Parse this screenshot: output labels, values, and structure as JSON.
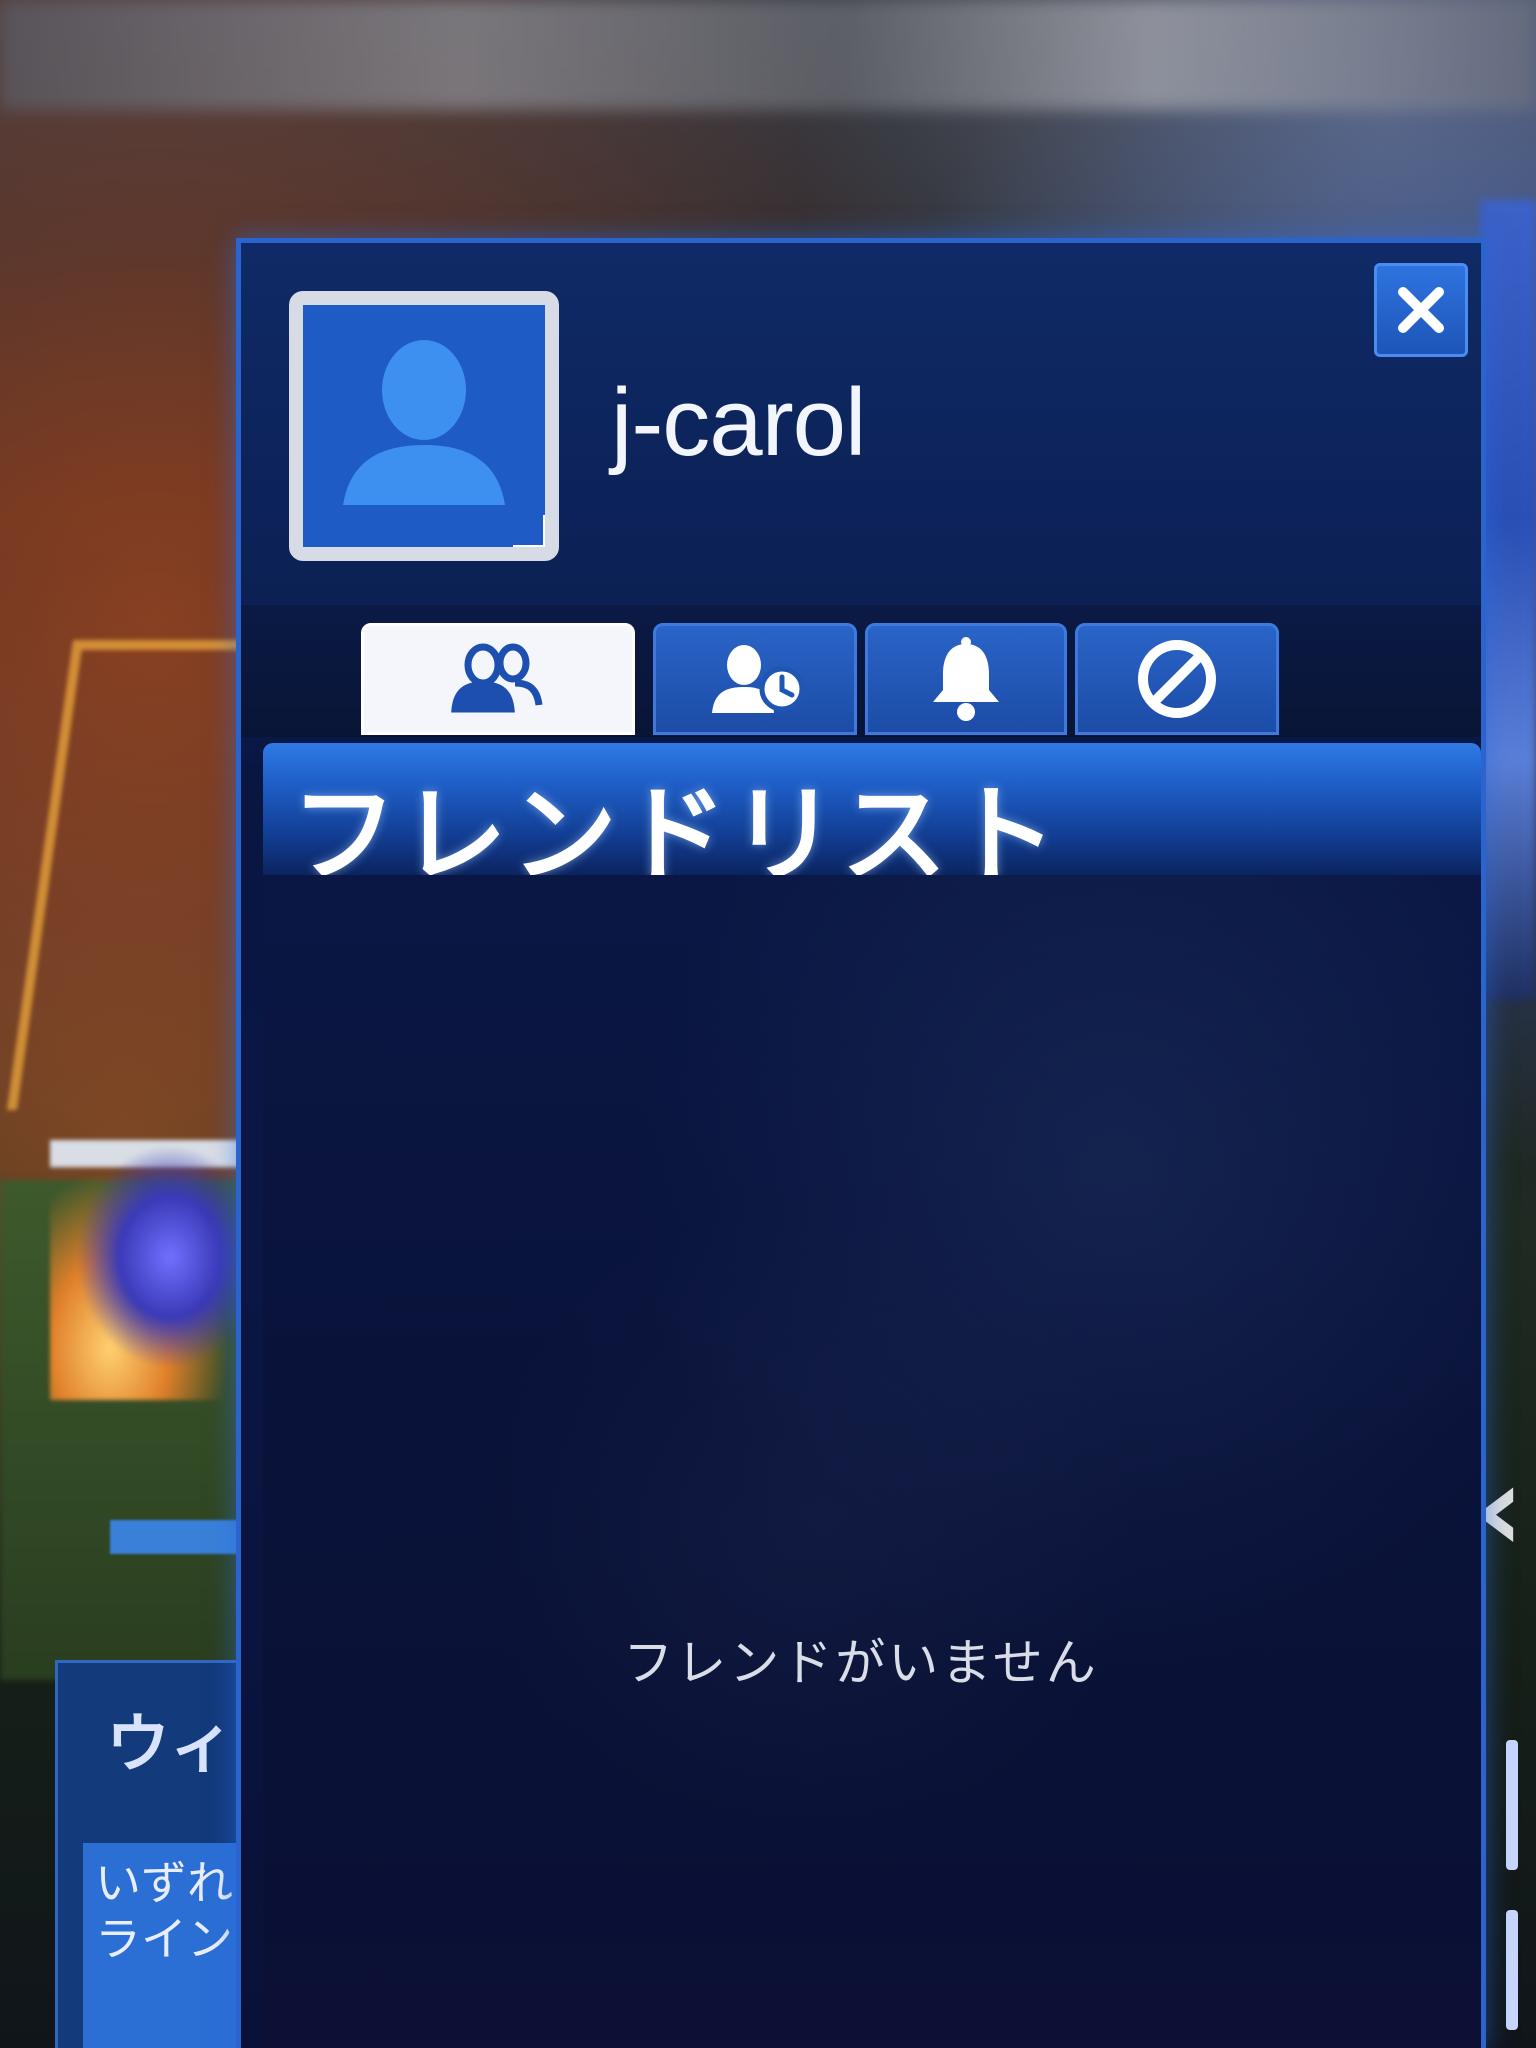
{
  "user": {
    "name": "j-carol",
    "avatar_icon": "person-silhouette-icon"
  },
  "tabs": [
    {
      "id": "friends",
      "icon": "friends-icon",
      "active": true
    },
    {
      "id": "friend-requests",
      "icon": "friend-pending-icon",
      "active": false
    },
    {
      "id": "notifications",
      "icon": "bell-icon",
      "active": false
    },
    {
      "id": "blocked",
      "icon": "block-icon",
      "active": false
    }
  ],
  "close_icon": "close-icon",
  "friend_list": {
    "title": "フレンドリスト",
    "empty_message": "フレンドがいません"
  },
  "background": {
    "left_card_title": "ウィ",
    "left_card_text": "いずれ\nライン"
  },
  "colors": {
    "panel_border": "#2b64cc",
    "panel_bg": "#0a1745",
    "tab_active_bg": "#f4f6fb",
    "tab_inactive_bg": "#2a64c8",
    "icon_on_active": "#1d4fb0",
    "icon_on_inactive": "#ffffff"
  }
}
